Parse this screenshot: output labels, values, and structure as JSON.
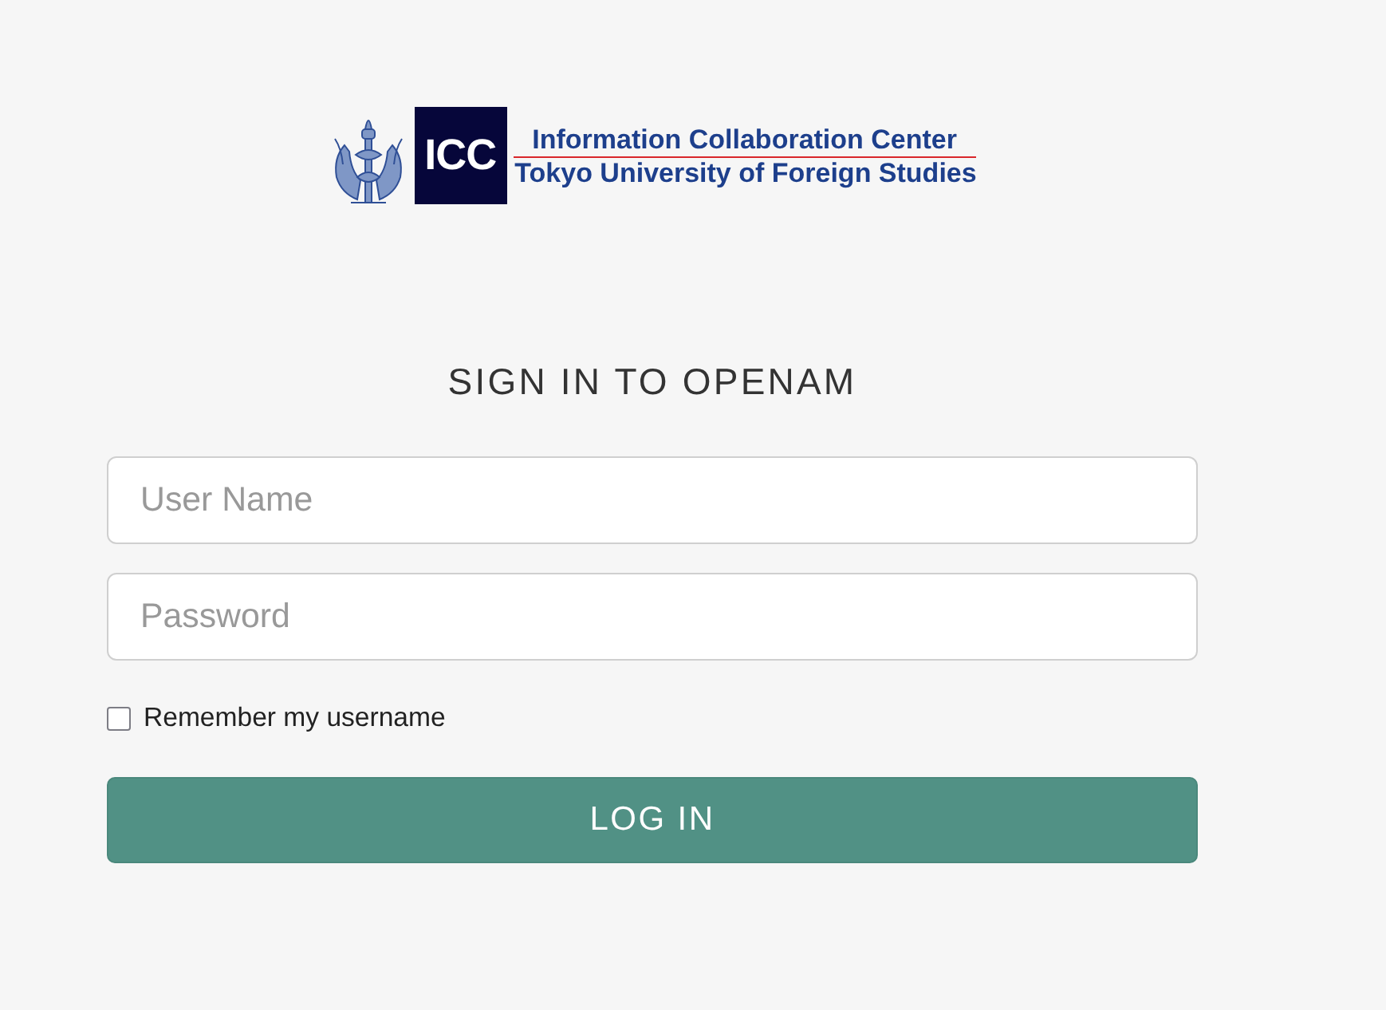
{
  "logo": {
    "badge": "ICC",
    "line_1": "Information Collaboration Center",
    "line_2": "Tokyo University of Foreign Studies"
  },
  "heading": "SIGN IN TO OPENAM",
  "fields": [
    {
      "placeholder": "User Name"
    },
    {
      "placeholder": "Password"
    }
  ],
  "remember": {
    "label": "Remember my username",
    "checked": false
  },
  "button": "LOG IN"
}
